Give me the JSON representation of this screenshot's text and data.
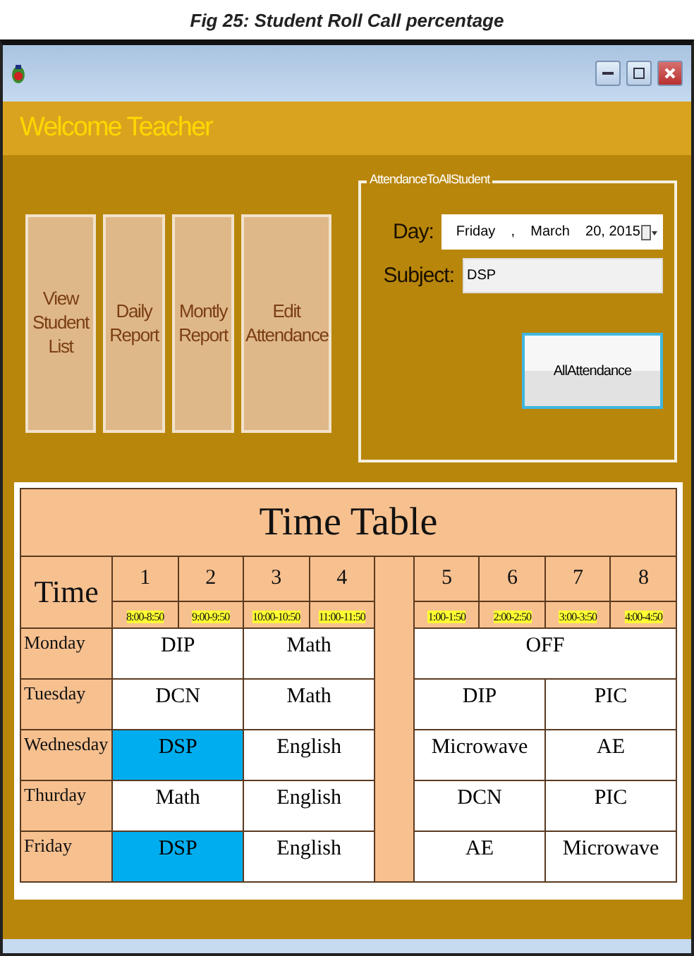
{
  "caption": "Fig 25: Student Roll Call percentage",
  "window": {
    "title": "Welcome Teacher"
  },
  "menu_buttons": [
    "View Student List",
    "Daily Report",
    "Montly Report",
    "Edit Attendance"
  ],
  "attendance_group": {
    "title": "AttendanceToAllStudent",
    "day_label": "Day:",
    "day_value": "Friday    ,    March    20, 2015",
    "subject_label": "Subject:",
    "subject_value": "DSP",
    "button": "AllAttendance"
  },
  "timetable": {
    "title": "Time Table",
    "time_header": "Time",
    "periods": [
      {
        "number": "1",
        "time": "8:00-8:50"
      },
      {
        "number": "2",
        "time": "9:00-9:50"
      },
      {
        "number": "3",
        "time": "10:00-10:50"
      },
      {
        "number": "4",
        "time": "11:00-11:50"
      },
      {
        "number": "5",
        "time": "1:00-1:50"
      },
      {
        "number": "6",
        "time": "2:00-2:50"
      },
      {
        "number": "7",
        "time": "3:00-3:50"
      },
      {
        "number": "8",
        "time": "4:00-4:50"
      }
    ],
    "rows": [
      {
        "day": "Monday",
        "morning": [
          {
            "subject": "DIP",
            "color": "#ffffff"
          },
          {
            "subject": "Math",
            "color": "#ffffff"
          }
        ],
        "afternoon": [
          {
            "subject": "OFF",
            "color": "#ffffff"
          }
        ]
      },
      {
        "day": "Tuesday",
        "morning": [
          {
            "subject": "DCN",
            "color": "#ffffff"
          },
          {
            "subject": "Math",
            "color": "#ffffff"
          }
        ],
        "afternoon": [
          {
            "subject": "DIP",
            "color": "#ffffff"
          },
          {
            "subject": "PIC",
            "color": "#ffffff"
          }
        ]
      },
      {
        "day": "Wednesday",
        "morning": [
          {
            "subject": "DSP",
            "color": "#00aeef"
          },
          {
            "subject": "English",
            "color": "#ffffff"
          }
        ],
        "afternoon": [
          {
            "subject": "Microwave",
            "color": "#ffffff"
          },
          {
            "subject": "AE",
            "color": "#ffffff"
          }
        ]
      },
      {
        "day": "Thurday",
        "morning": [
          {
            "subject": "Math",
            "color": "#ffffff"
          },
          {
            "subject": "English",
            "color": "#ffffff"
          }
        ],
        "afternoon": [
          {
            "subject": "DCN",
            "color": "#ffffff"
          },
          {
            "subject": "PIC",
            "color": "#ffffff"
          }
        ]
      },
      {
        "day": "Friday",
        "morning": [
          {
            "subject": "DSP",
            "color": "#00aeef"
          },
          {
            "subject": "English",
            "color": "#ffffff"
          }
        ],
        "afternoon": [
          {
            "subject": "AE",
            "color": "#ffffff"
          },
          {
            "subject": "Microwave",
            "color": "#ffffff"
          }
        ]
      }
    ]
  }
}
